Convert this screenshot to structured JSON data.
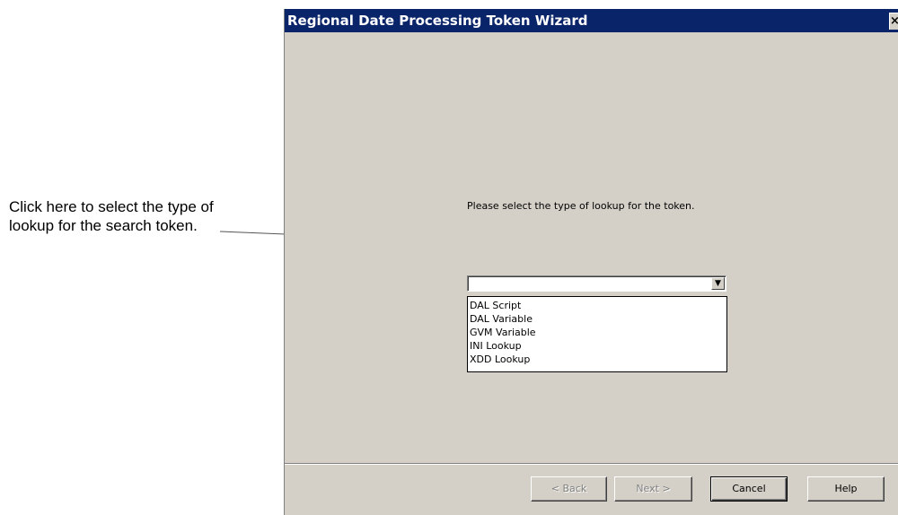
{
  "callout": {
    "line1": "Click here to select the type of",
    "line2": "lookup for the search token."
  },
  "dialog": {
    "title": "Regional Date Processing Token Wizard",
    "close_glyph": "×",
    "prompt": "Please select the type of lookup for the token.",
    "combo": {
      "value": "",
      "arrow_glyph": "▼"
    },
    "dropdown_options": [
      "DAL Script",
      "DAL Variable",
      "GVM Variable",
      "INI Lookup",
      "XDD Lookup"
    ],
    "buttons": {
      "back": "< Back",
      "next": "Next >",
      "cancel": "Cancel",
      "help": "Help"
    }
  }
}
